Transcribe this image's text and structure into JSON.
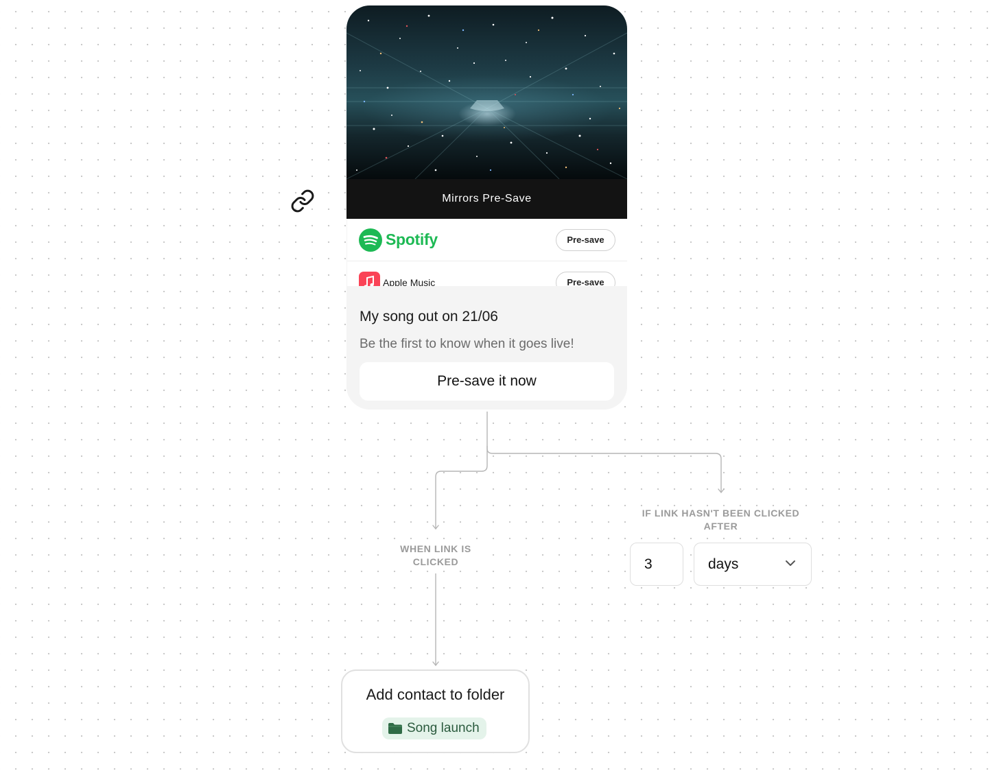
{
  "preview": {
    "hero_title": "Mirrors Pre-Save",
    "services": [
      {
        "name": "Spotify",
        "button": "Pre-save",
        "icon": "spotify-icon",
        "brand_color": "#1db954"
      },
      {
        "name": "Apple Music",
        "button": "Pre-save",
        "icon": "apple-music-icon",
        "brand_color": "#fa4356"
      }
    ],
    "title": "My song out on 21/06",
    "subtitle": "Be the first to know when it goes live!",
    "cta": "Pre-save it now"
  },
  "link_icon": "link-icon",
  "branches": {
    "clicked_label": "WHEN LINK IS CLICKED",
    "not_clicked_label": "IF LINK HASN'T BEEN CLICKED AFTER",
    "delay_value": "3",
    "delay_unit": "days"
  },
  "action": {
    "title": "Add contact to folder",
    "folder_name": "Song launch",
    "folder_icon": "folder-icon",
    "chip_color": "#e4f3ea"
  }
}
